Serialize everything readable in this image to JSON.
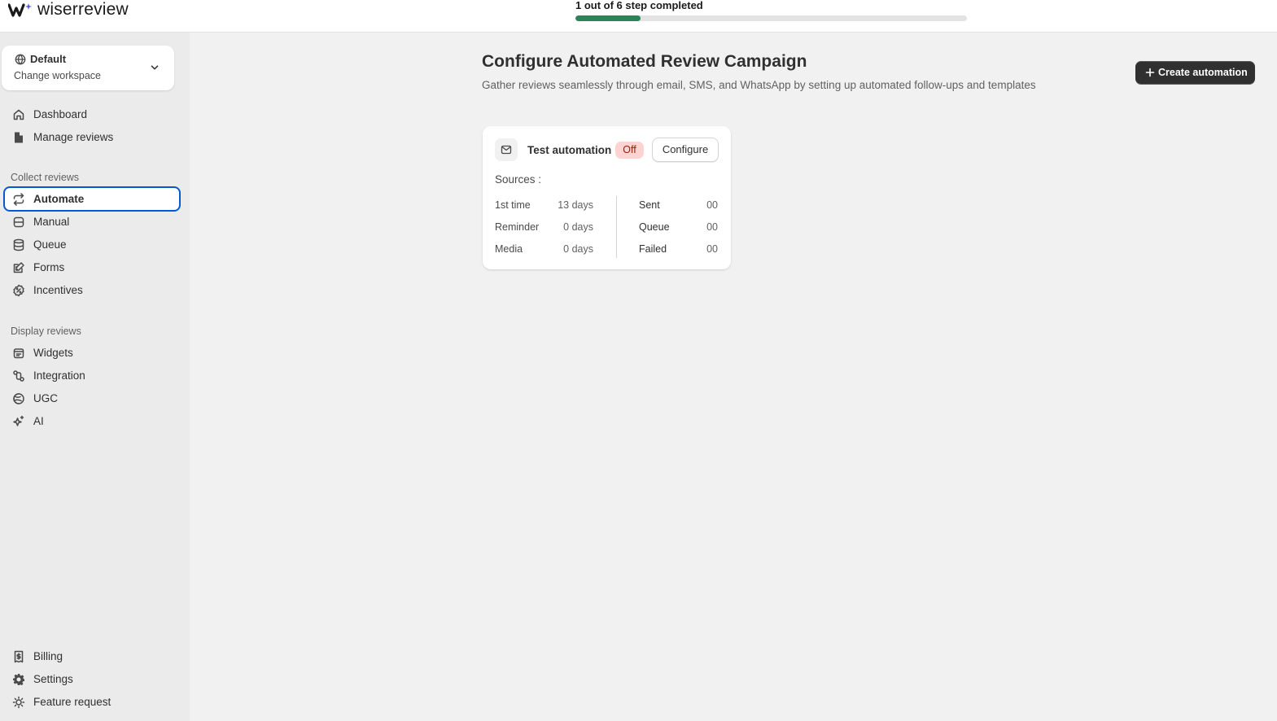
{
  "app": {
    "name": "wiserreview"
  },
  "onboarding": {
    "label": "1 out of 6 step completed",
    "completed": 1,
    "total": 6,
    "progress_fraction": 0.1667
  },
  "colors": {
    "accent_focus": "#005bd3",
    "progress_fill": "#29845a",
    "primary_button": "#303030",
    "off_badge_bg": "#fed3d1",
    "off_badge_text": "#8e1f0b"
  },
  "workspace": {
    "name": "Default",
    "action": "Change workspace",
    "icon": "globe-icon",
    "chevron": "chevron-down-icon"
  },
  "sidebar": {
    "top_items": [
      {
        "label": "Dashboard",
        "icon": "home-icon"
      },
      {
        "label": "Manage reviews",
        "icon": "file-icon"
      }
    ],
    "collect_label": "Collect reviews",
    "collect_items": [
      {
        "label": "Automate",
        "icon": "repeat-icon",
        "active": true
      },
      {
        "label": "Manual",
        "icon": "inbox-icon"
      },
      {
        "label": "Queue",
        "icon": "database-icon"
      },
      {
        "label": "Forms",
        "icon": "edit-form-icon"
      },
      {
        "label": "Incentives",
        "icon": "discount-icon"
      }
    ],
    "display_label": "Display reviews",
    "display_items": [
      {
        "label": "Widgets",
        "icon": "widget-icon"
      },
      {
        "label": "Integration",
        "icon": "integration-icon"
      },
      {
        "label": "UGC",
        "icon": "ugc-icon"
      },
      {
        "label": "AI",
        "icon": "sparkle-icon"
      }
    ],
    "bottom_items": [
      {
        "label": "Billing",
        "icon": "receipt-icon"
      },
      {
        "label": "Settings",
        "icon": "gear-icon"
      },
      {
        "label": "Feature request",
        "icon": "lightbulb-icon"
      }
    ]
  },
  "main": {
    "title": "Configure Automated Review Campaign",
    "description": "Gather reviews seamlessly through email, SMS, and WhatsApp by setting up automated follow-ups and templates",
    "create_button": "Create automation"
  },
  "automation_card": {
    "icon": "mail-icon",
    "name": "Test automation",
    "status": "Off",
    "configure_label": "Configure",
    "sources_label": "Sources :",
    "schedule": [
      {
        "label": "1st time",
        "value": "13 days"
      },
      {
        "label": "Reminder",
        "value": "0 days"
      },
      {
        "label": "Media",
        "value": "0 days"
      }
    ],
    "stats": [
      {
        "label": "Sent",
        "value": "00"
      },
      {
        "label": "Queue",
        "value": "00"
      },
      {
        "label": "Failed",
        "value": "00"
      }
    ]
  }
}
